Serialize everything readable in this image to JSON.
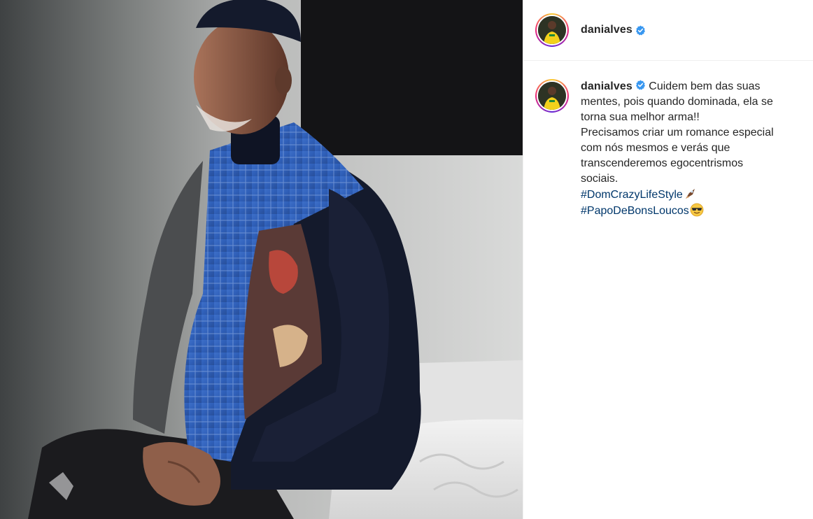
{
  "post": {
    "image_alt": "",
    "author": {
      "username": "danialves",
      "verified": true,
      "avatar_icon": "profile-avatar"
    },
    "caption": {
      "lines": [
        "Cuidem bem das suas",
        "mentes, pois quando dominada, ela se",
        "torna sua melhor arma!!",
        "Precisamos criar um romance especial",
        "com nós mesmos e verás que",
        "transcenderemos egocentrismos",
        "sociais."
      ],
      "hashtags": [
        {
          "text": "#DomCrazyLifeStyle",
          "emoji_icon": "rocket-emoji-icon"
        },
        {
          "text": "#PapoDeBonsLoucos",
          "emoji_icon": "sunglasses-emoji-icon"
        }
      ]
    }
  },
  "colors": {
    "verified_badge": "#3897f0",
    "hashtag": "#00376b",
    "text": "#262626",
    "divider": "#efefef"
  }
}
